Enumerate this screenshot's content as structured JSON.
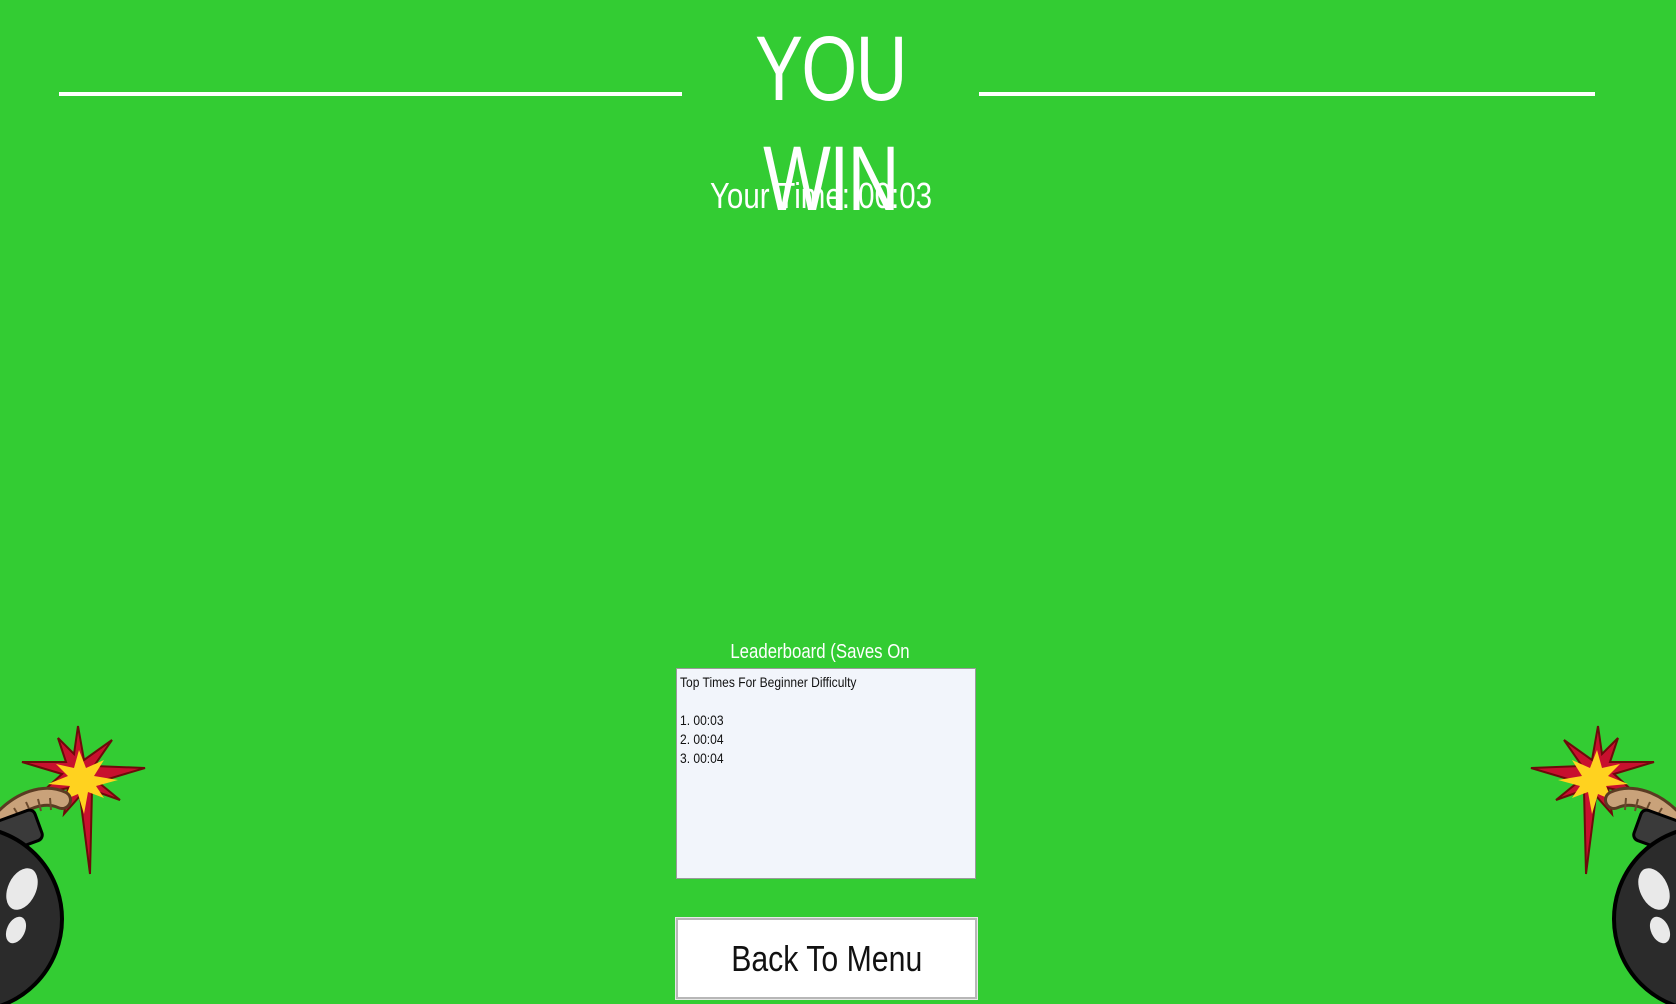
{
  "screen": {
    "title": "YOU WIN",
    "your_time": "Your Time: 00:03"
  },
  "leaderboard": {
    "label": "Leaderboard (Saves On Restart)",
    "lines": [
      "Top Times For Beginner Difficulty",
      "",
      "1. 00:03",
      "2. 00:04",
      "3. 00:04"
    ]
  },
  "buttons": {
    "back_to_menu": "Back To Menu"
  },
  "icons": {
    "left_decoration": "bomb-icon",
    "right_decoration": "bomb-icon"
  },
  "colors": {
    "background": "#33cc33",
    "text": "#ffffff",
    "leaderboard_bg": "#f2f5fb"
  }
}
